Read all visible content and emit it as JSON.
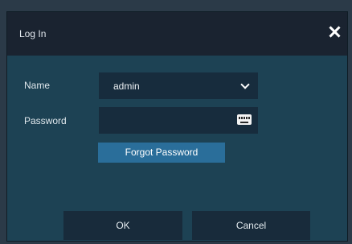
{
  "dialog": {
    "title": "Log In",
    "close_icon": "close-icon"
  },
  "form": {
    "name_label": "Name",
    "name_value": "admin",
    "password_label": "Password",
    "password_value": "",
    "keyboard_icon": "keyboard-icon",
    "dropdown_icon": "chevron-down-icon",
    "forgot_label": "Forgot Password"
  },
  "buttons": {
    "ok_label": "OK",
    "cancel_label": "Cancel"
  },
  "colors": {
    "titlebar": "#1a2330",
    "body": "#1d4254",
    "field": "#172c3d",
    "accent": "#2a6e9a"
  }
}
